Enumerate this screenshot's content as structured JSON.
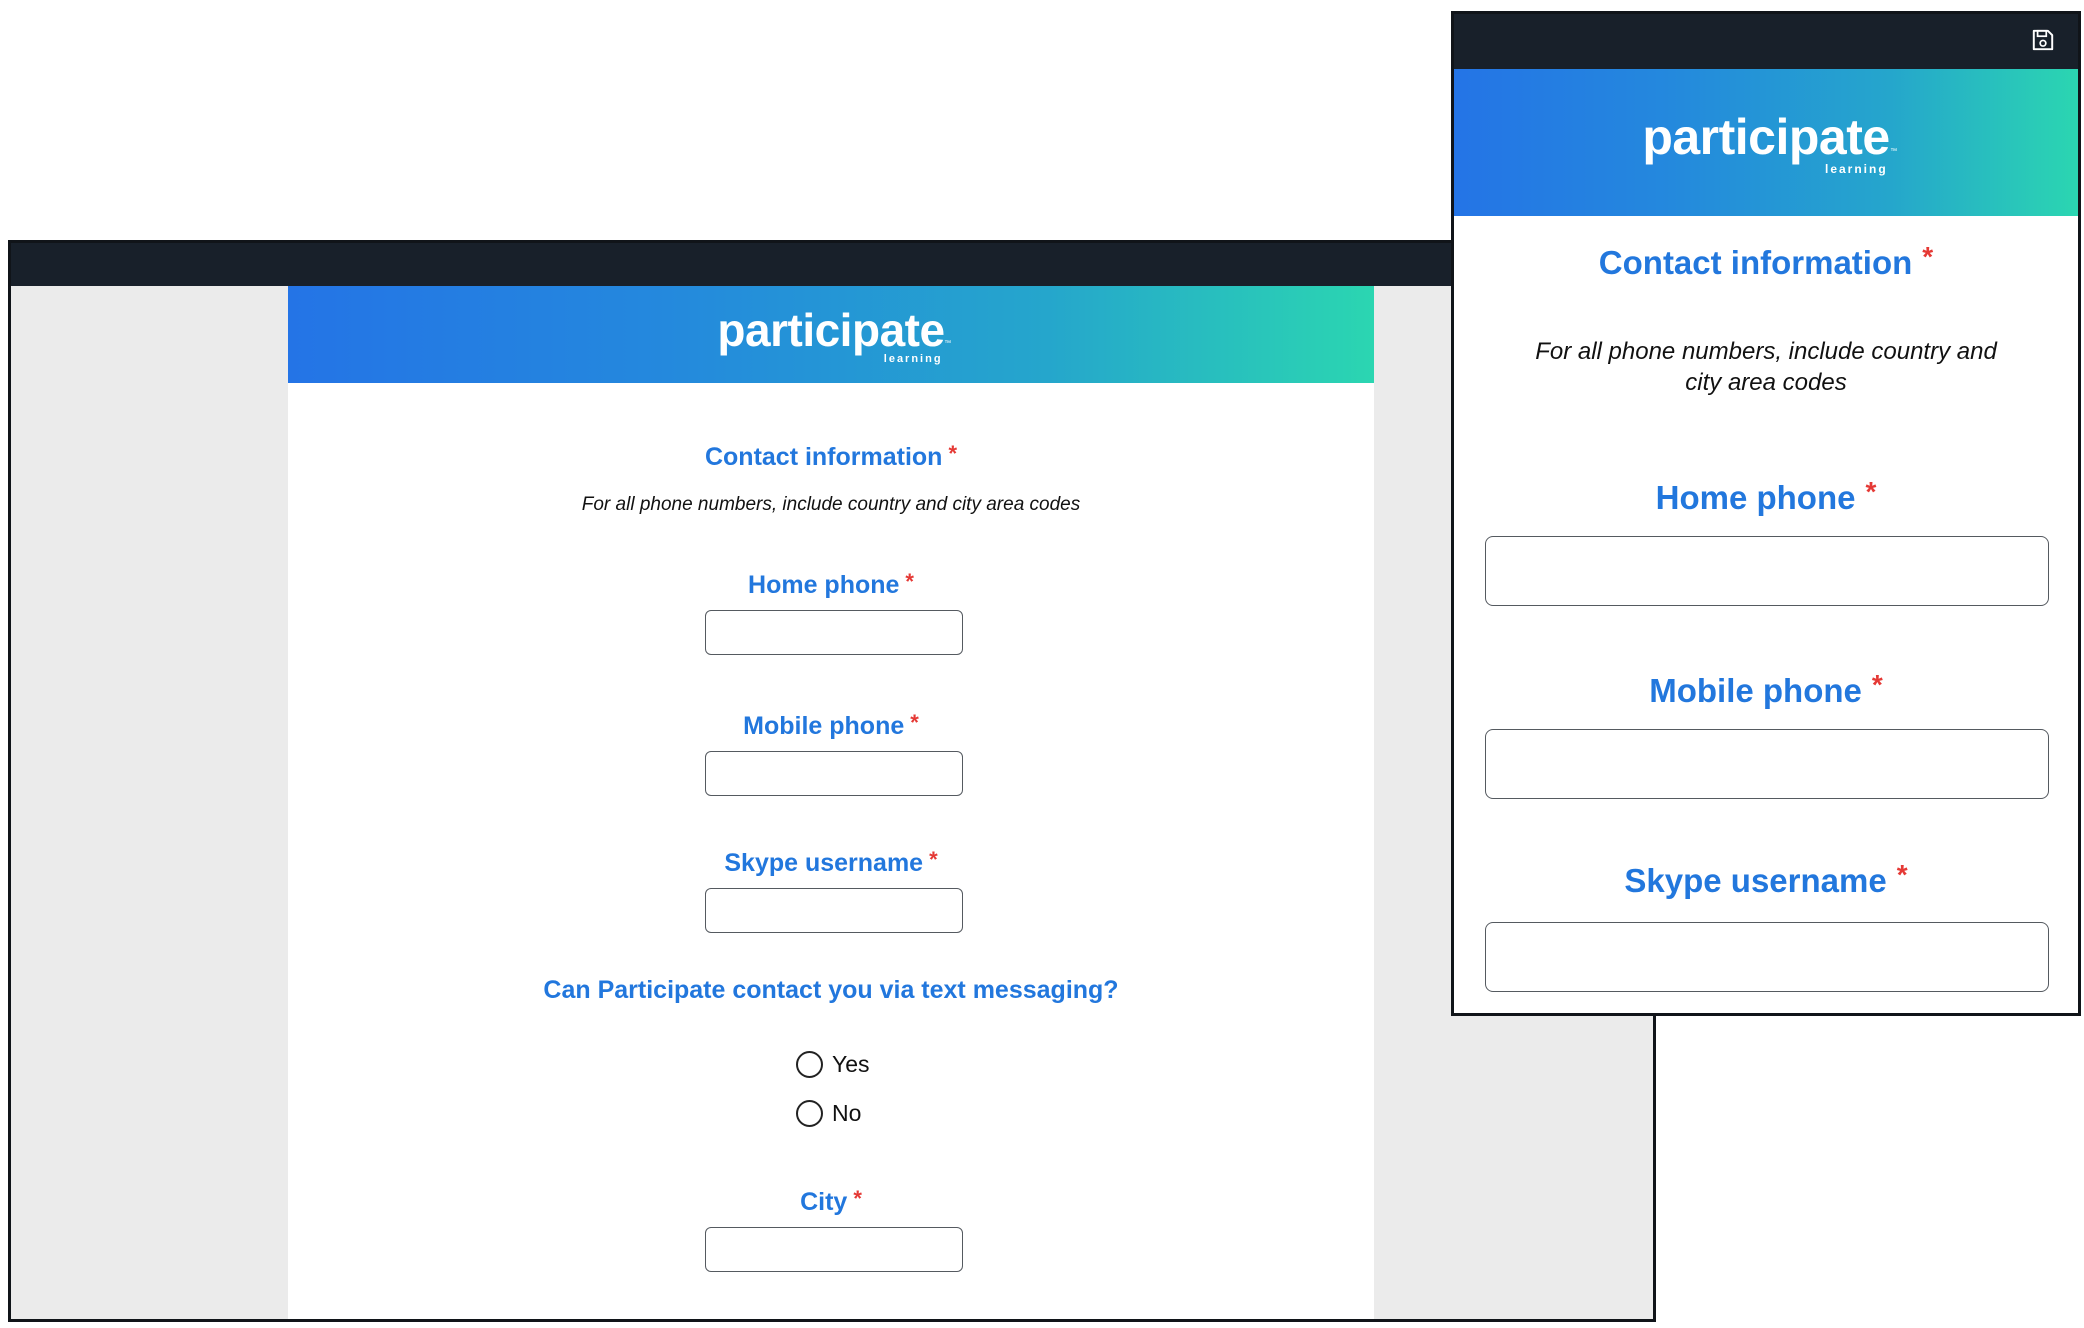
{
  "brand": {
    "logo_text": "participate",
    "logo_sub": "learning",
    "logo_tm": "™",
    "gradient": [
      "#2474e6",
      "#2bd6b1"
    ],
    "accent": "#2277dd",
    "required_color": "#e53935",
    "titlebar_color": "#18202a"
  },
  "form": {
    "section_title": "Contact information",
    "required_mark": "*",
    "note": "For all phone numbers, include country and city area codes",
    "fields": {
      "home_phone": {
        "label": "Home phone",
        "value": ""
      },
      "mobile_phone": {
        "label": "Mobile phone",
        "value": ""
      },
      "skype": {
        "label": "Skype username",
        "value": ""
      },
      "city": {
        "label": "City",
        "value": ""
      }
    },
    "text_question": {
      "label": "Can Participate contact you via text messaging?",
      "options": [
        "Yes",
        "No"
      ]
    }
  },
  "mobile": {
    "save_icon": "save-icon"
  }
}
